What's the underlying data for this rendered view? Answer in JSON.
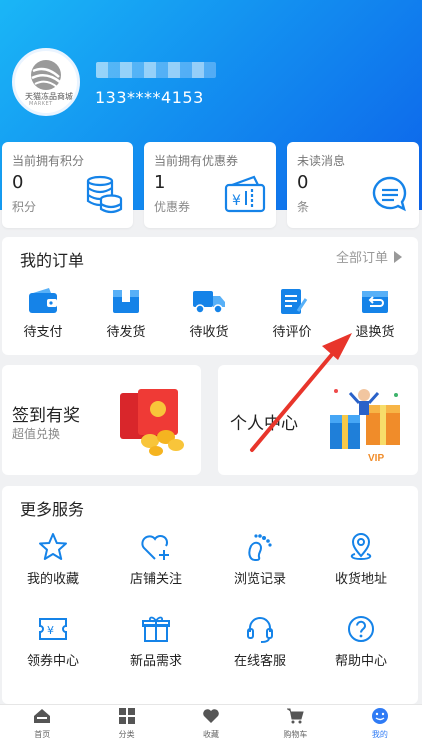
{
  "profile": {
    "avatar_brand": "天猫冻品商城",
    "avatar_brand_sub": "MARKET",
    "phone": "133****4153"
  },
  "stats": [
    {
      "title": "当前拥有积分",
      "value": "0",
      "unit": "积分",
      "icon": "database-icon"
    },
    {
      "title": "当前拥有优惠券",
      "value": "1",
      "unit": "优惠券",
      "icon": "coupon-icon"
    },
    {
      "title": "未读消息",
      "value": "0",
      "unit": "条",
      "icon": "message-icon"
    }
  ],
  "orders": {
    "title": "我的订单",
    "all_label": "全部订单",
    "items": [
      {
        "label": "待支付",
        "icon": "wallet-icon"
      },
      {
        "label": "待发货",
        "icon": "package-icon"
      },
      {
        "label": "待收货",
        "icon": "truck-icon"
      },
      {
        "label": "待评价",
        "icon": "edit-document-icon"
      },
      {
        "label": "退换货",
        "icon": "return-box-icon"
      }
    ]
  },
  "promos": {
    "checkin_title": "签到有奖",
    "checkin_sub": "超值兑换",
    "personal_title": "个人中心",
    "vip_label": "VIP"
  },
  "services": {
    "title": "更多服务",
    "items": [
      {
        "label": "我的收藏",
        "icon": "star-icon"
      },
      {
        "label": "店铺关注",
        "icon": "heart-plus-icon"
      },
      {
        "label": "浏览记录",
        "icon": "footprint-icon"
      },
      {
        "label": "收货地址",
        "icon": "location-pin-icon"
      },
      {
        "label": "领券中心",
        "icon": "ticket-icon"
      },
      {
        "label": "新品需求",
        "icon": "gift-icon"
      },
      {
        "label": "在线客服",
        "icon": "headset-icon"
      },
      {
        "label": "帮助中心",
        "icon": "help-circle-icon"
      }
    ]
  },
  "tabbar": {
    "items": [
      {
        "label": "首页",
        "icon": "home-icon"
      },
      {
        "label": "分类",
        "icon": "grid-icon"
      },
      {
        "label": "收藏",
        "icon": "heart-icon"
      },
      {
        "label": "购物车",
        "icon": "cart-icon"
      },
      {
        "label": "我的",
        "icon": "smile-face-icon"
      }
    ],
    "active_index": 4
  },
  "colors": {
    "accent": "#2f7bf5",
    "hero_start": "#1ab6f6",
    "hero_end": "#0d63ea",
    "arrow": "#e8352b"
  }
}
